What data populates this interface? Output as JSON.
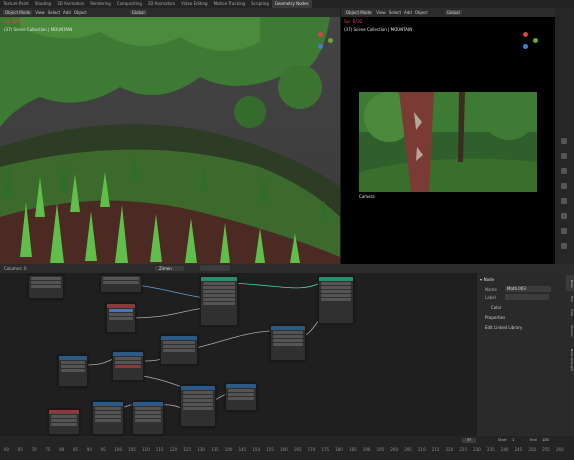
{
  "workspace_tabs": [
    "Texture Paint",
    "Shading",
    "3D Animation",
    "Rendering",
    "Compositing",
    "2D Animation",
    "Video Editing",
    "Motion Tracking",
    "Scripting",
    "Geometry Nodes"
  ],
  "active_tab": "Geometry Nodes",
  "left_viewport": {
    "mode": "Object Mode",
    "menus": [
      "View",
      "Select",
      "Add",
      "Object"
    ],
    "transform": "Global",
    "sample": "Sa: 8/50",
    "collection": "(37) Scene Collection | MOUNTAIN"
  },
  "right_viewport": {
    "mode": "Object Mode",
    "menus": [
      "View",
      "Select",
      "Add",
      "Object"
    ],
    "transform": "Global",
    "sample": "Sa: 6/32",
    "collection": "(37) Scene Collection | MOUNTAIN",
    "camera_label": "Camera"
  },
  "node_editor": {
    "left_status": "Columns: 0",
    "tree_name": "Zimen"
  },
  "sidebar": {
    "tabs": [
      "Node",
      "Tool",
      "View",
      "Options",
      "Node Wrangler"
    ],
    "panel_title": "Node",
    "name_label": "Name",
    "name_value": "Math.003",
    "label_label": "Label",
    "color_label": "Color",
    "properties_label": "Properties",
    "edit_linked_label": "Edit Linked Library"
  },
  "timeline": {
    "current_frame": "37",
    "start_label": "Start",
    "start_value": "1",
    "end_label": "End",
    "end_value": "120",
    "ticks": [
      "60",
      "65",
      "70",
      "75",
      "80",
      "85",
      "90",
      "95",
      "100",
      "105",
      "110",
      "115",
      "120",
      "125",
      "130",
      "135",
      "140",
      "145",
      "150",
      "155",
      "160",
      "165",
      "170",
      "175",
      "180",
      "185",
      "190",
      "195",
      "200",
      "205",
      "210",
      "215",
      "220",
      "225",
      "230",
      "235",
      "240",
      "245",
      "250",
      "255",
      "260"
    ]
  },
  "colors": {
    "bg": "#1d1d1d",
    "header": "#2b2b2b",
    "accent_select": "#4a76b8",
    "tree_green": "#3c7a32",
    "grass": "#58b446",
    "node_geometry_green": "#2a8c6a",
    "node_blue": "#2b5a86",
    "node_red": "#8a3a3a"
  }
}
